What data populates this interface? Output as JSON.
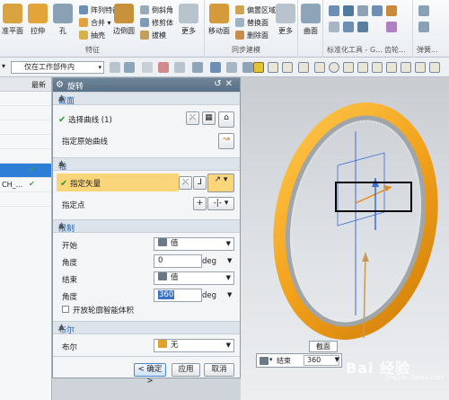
{
  "ribbon": {
    "big_buttons": [
      {
        "label": "基准平面",
        "shown": "准平面"
      },
      {
        "label": "拉伸"
      },
      {
        "label": "孔"
      },
      {
        "label": "边倒圆"
      },
      {
        "label": "更多"
      },
      {
        "label": "移动面"
      },
      {
        "label": "更多"
      },
      {
        "label": "曲面"
      },
      {
        "label": "更多"
      }
    ],
    "small_buttons": [
      {
        "label": "阵列特征"
      },
      {
        "label": "合并 ▾"
      },
      {
        "label": "抽壳"
      },
      {
        "label": "倒斜角"
      },
      {
        "label": "修剪体"
      },
      {
        "label": "拔模"
      },
      {
        "label": "偏置区域"
      },
      {
        "label": "替换面"
      },
      {
        "label": "删除面"
      }
    ],
    "group_labels": {
      "feature": "特征",
      "sync": "同步建模",
      "std_tools": "标准化工具 - G...",
      "gear": "齿轮...",
      "spring": "弹簧..."
    }
  },
  "toolbar": {
    "selection_filter": "仅在工作部件内"
  },
  "navigator": {
    "column_latest": "最新",
    "rows": [
      {
        "text": "",
        "check": false,
        "selected": false
      },
      {
        "text": "",
        "check": false,
        "selected": false
      },
      {
        "text": "",
        "check": false,
        "selected": false
      },
      {
        "text": "",
        "check": false,
        "selected": false
      },
      {
        "text": "",
        "check": false,
        "selected": false
      },
      {
        "text": "",
        "check": true,
        "selected": true
      },
      {
        "text": "CH_...",
        "check": true,
        "selected": false
      }
    ]
  },
  "dialog": {
    "title": "旋转",
    "sections": {
      "section": {
        "header": "截面",
        "select_curve": "选择曲线 (1)",
        "specify_origin_curve": "指定原始曲线"
      },
      "axis": {
        "header": "轴",
        "specify_vector": "指定矢量",
        "specify_point": "指定点"
      },
      "limits": {
        "header": "限制",
        "start_label": "开始",
        "start_type": "值",
        "start_angle_label": "角度",
        "start_angle_value": "0",
        "start_angle_unit": "deg",
        "end_label": "结束",
        "end_type": "值",
        "end_angle_label": "角度",
        "end_angle_value": "360",
        "end_angle_unit": "deg",
        "open_profile_smart_volume": "开放轮廓智能体积"
      },
      "boolean": {
        "header": "布尔",
        "label": "布尔",
        "value": "无"
      }
    },
    "buttons": {
      "ok": "< 确定 >",
      "apply": "应用",
      "cancel": "取消"
    }
  },
  "viewport": {
    "dynamic_label": "截面",
    "dynamic_end_label": "结束",
    "dynamic_end_value": "360",
    "watermark": "Bai 经验",
    "watermark_url": "jingyan.baidu.com"
  },
  "colors": {
    "ring_orange": "#f2a21b",
    "ring_gray": "#9fa5a8",
    "axis_blue": "#3a6fd8",
    "highlight_row": "#fbd57a",
    "section_header_text": "#2160a8"
  }
}
